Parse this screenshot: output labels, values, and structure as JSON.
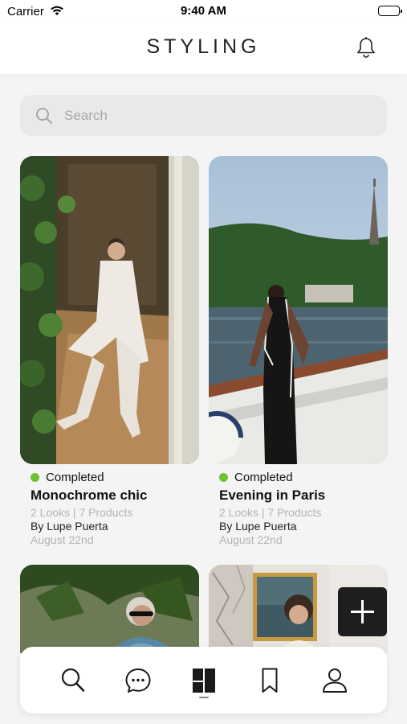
{
  "status_bar": {
    "carrier": "Carrier",
    "time": "9:40 AM",
    "icons": [
      "wifi-icon",
      "battery-icon"
    ]
  },
  "header": {
    "title": "STYLING",
    "icon": "bell-icon"
  },
  "search": {
    "placeholder": "Search",
    "icon": "search-icon"
  },
  "cards": [
    {
      "status": "Completed",
      "name": "Monochrome chic",
      "meta": "2 Looks | 7 Products",
      "author": "By Lupe Puerta",
      "date": "August 22nd"
    },
    {
      "status": "Completed",
      "name": "Evening in Paris",
      "meta": "2 Looks | 7 Products",
      "author": "By Lupe Puerta",
      "date": "August 22nd"
    }
  ],
  "fab": {
    "icon": "plus-icon"
  },
  "tabbar": {
    "tabs": [
      "search-icon",
      "chat-icon",
      "styling-grid-icon",
      "bookmark-icon",
      "profile-icon"
    ],
    "active_index": 2
  },
  "colors": {
    "status_completed": "#6cc430",
    "fab_background": "#1e1e1e",
    "search_background": "#e9e9e9"
  }
}
